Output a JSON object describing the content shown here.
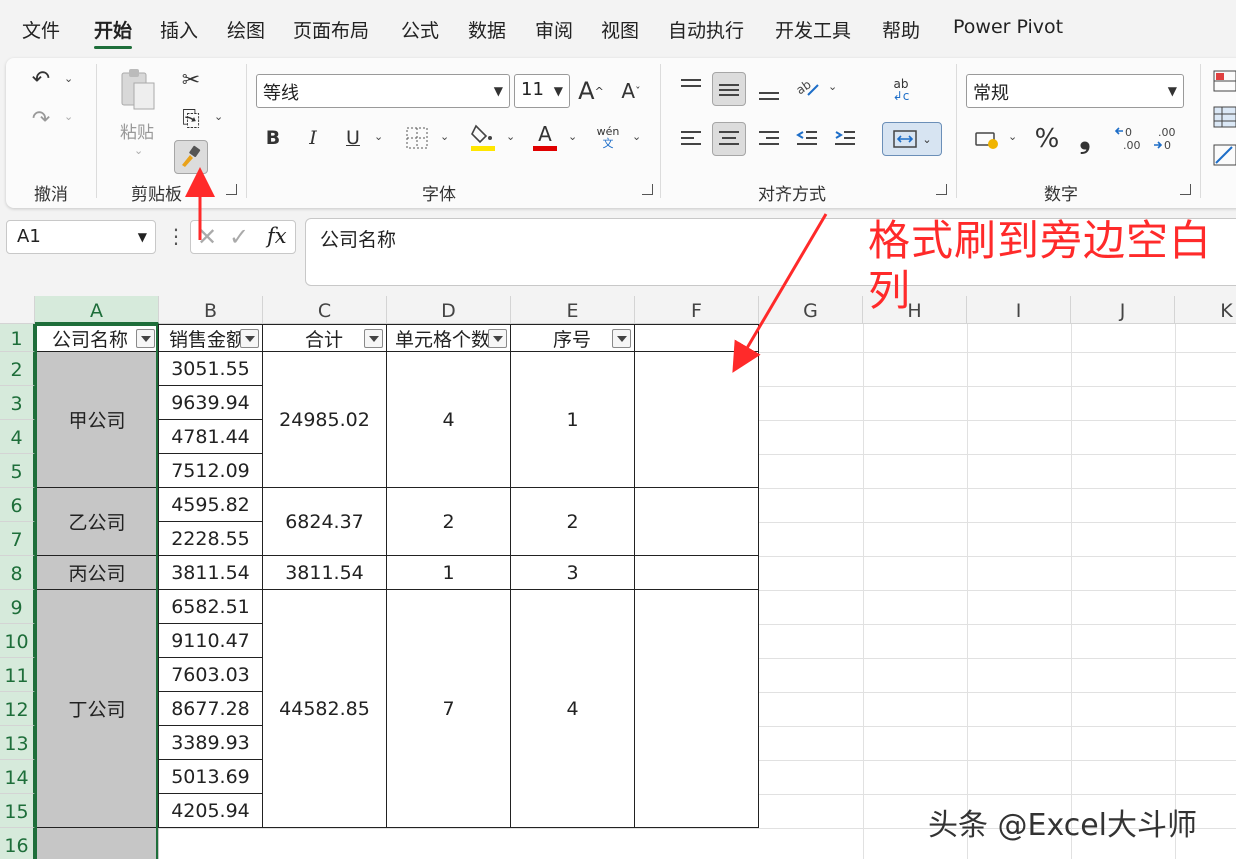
{
  "menu": {
    "items": [
      "文件",
      "开始",
      "插入",
      "绘图",
      "页面布局",
      "公式",
      "数据",
      "审阅",
      "视图",
      "自动执行",
      "开发工具",
      "帮助",
      "Power Pivot"
    ],
    "active": "开始"
  },
  "ribbon": {
    "undo_group": "撤消",
    "clipboard_group": "剪贴板",
    "paste_label": "粘贴",
    "font_group": "字体",
    "font_name": "等线",
    "font_size": "11",
    "bold": "B",
    "italic": "I",
    "underline": "U",
    "grow_font": "A",
    "shrink_font": "A",
    "font_color_glyph": "A",
    "phonetic_top": "wén",
    "phonetic_bottom": "文",
    "alignment_group": "对齐方式",
    "number_group": "数字",
    "number_format": "常规",
    "percent": "%",
    "comma": "❟",
    "abc_label": "ab",
    "accent_colors": {
      "highlight": "#ffe600",
      "font_color": "#e00000",
      "excel_green": "#1e6e3a"
    }
  },
  "formula_bar": {
    "name_box": "A1",
    "fx": "fx",
    "value": "公司名称"
  },
  "sheet": {
    "columns": [
      "A",
      "B",
      "C",
      "D",
      "E",
      "F",
      "G",
      "H",
      "I",
      "J",
      "K"
    ],
    "rows": [
      "1",
      "2",
      "3",
      "4",
      "5",
      "6",
      "7",
      "8",
      "9",
      "10",
      "11",
      "12",
      "13",
      "14",
      "15",
      "16"
    ],
    "headers": [
      "公司名称",
      "销售金额",
      "合计",
      "单元格个数",
      "序号"
    ],
    "sales": [
      "3051.55",
      "9639.94",
      "4781.44",
      "7512.09",
      "4595.82",
      "2228.55",
      "3811.54",
      "6582.51",
      "9110.47",
      "7603.03",
      "8677.28",
      "3389.93",
      "5013.69",
      "4205.94"
    ],
    "groups": [
      {
        "company": "甲公司",
        "total": "24985.02",
        "count": "4",
        "seq": "1"
      },
      {
        "company": "乙公司",
        "total": "6824.37",
        "count": "2",
        "seq": "2"
      },
      {
        "company": "丙公司",
        "total": "3811.54",
        "count": "1",
        "seq": "3"
      },
      {
        "company": "丁公司",
        "total": "44582.85",
        "count": "7",
        "seq": "4"
      }
    ]
  },
  "annotation": {
    "text": "格式刷到旁边空白列",
    "color": "#ff2a2a"
  },
  "watermark": "头条 @Excel大斗师"
}
